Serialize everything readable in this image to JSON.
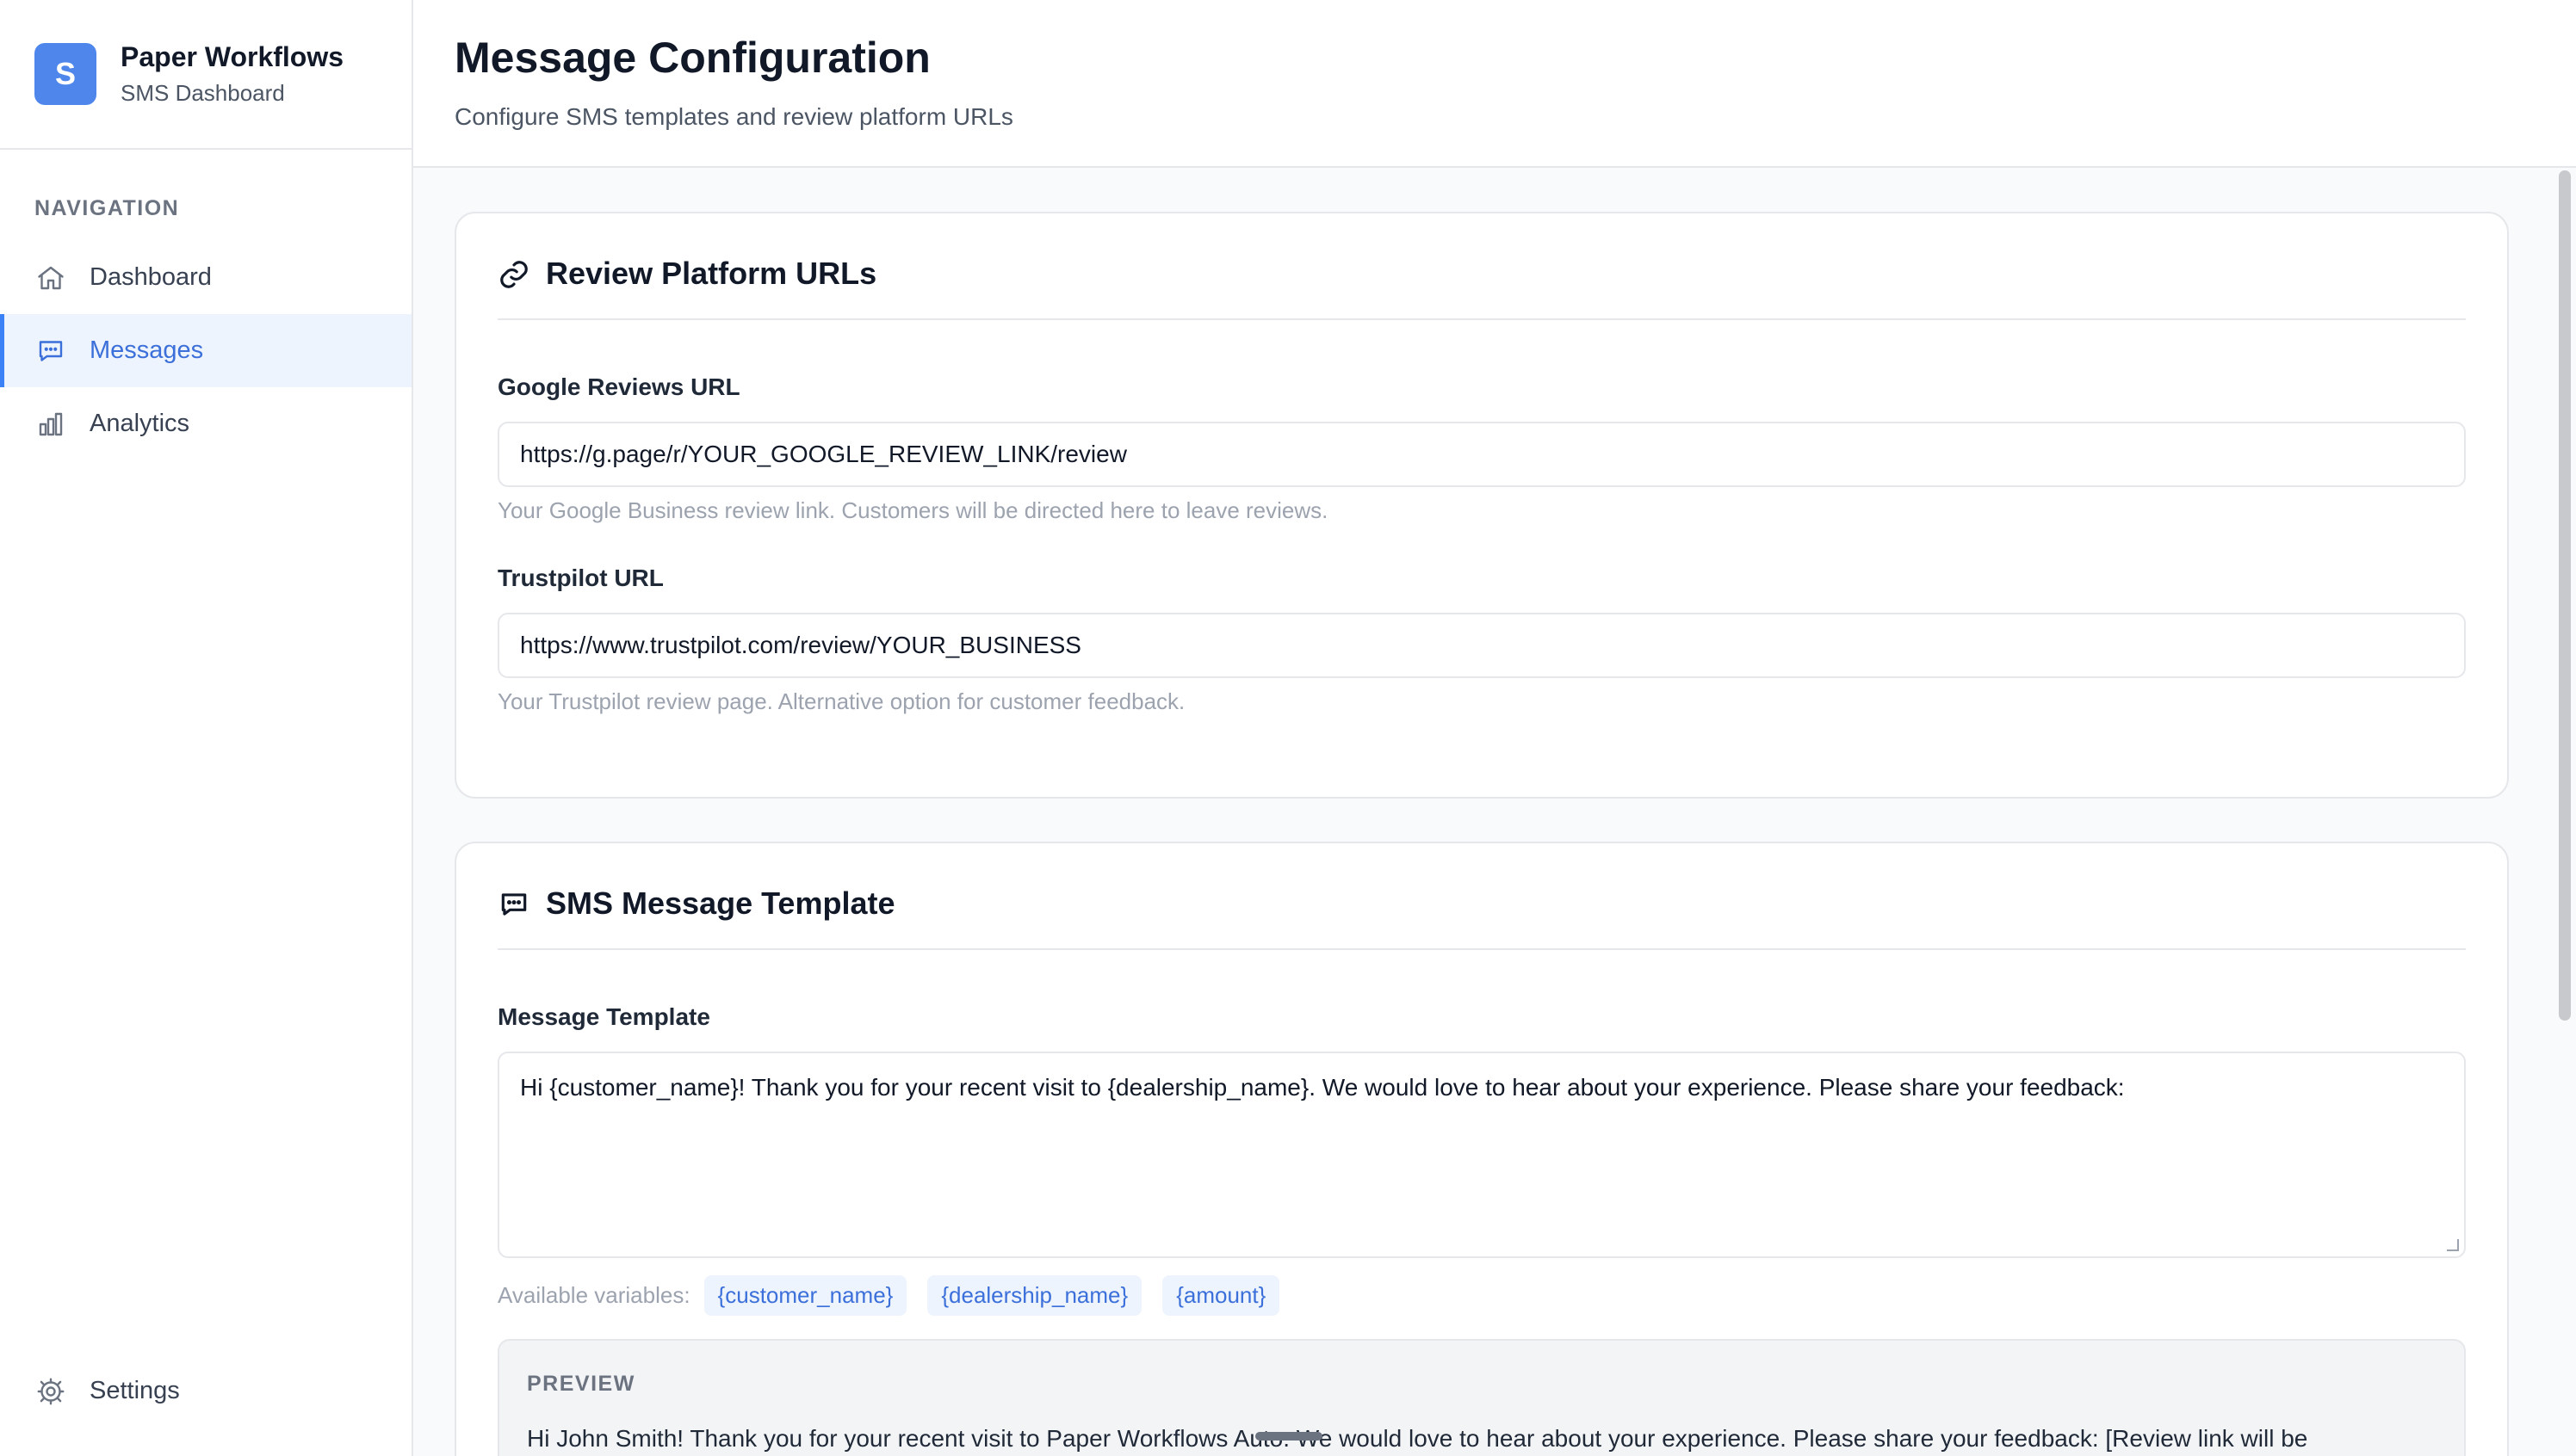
{
  "brand": {
    "logo_letter": "S",
    "title": "Paper Workflows",
    "subtitle": "SMS Dashboard"
  },
  "sidebar": {
    "heading": "NAVIGATION",
    "items": [
      {
        "label": "Dashboard",
        "icon": "home-icon",
        "active": false
      },
      {
        "label": "Messages",
        "icon": "chat-icon",
        "active": true
      },
      {
        "label": "Analytics",
        "icon": "bar-chart-icon",
        "active": false
      }
    ],
    "settings_label": "Settings"
  },
  "header": {
    "title": "Message Configuration",
    "subtitle": "Configure SMS templates and review platform URLs"
  },
  "review_card": {
    "title": "Review Platform URLs",
    "icon": "link-icon",
    "google": {
      "label": "Google Reviews URL",
      "value": "https://g.page/r/YOUR_GOOGLE_REVIEW_LINK/review",
      "help": "Your Google Business review link. Customers will be directed here to leave reviews."
    },
    "trustpilot": {
      "label": "Trustpilot URL",
      "value": "https://www.trustpilot.com/review/YOUR_BUSINESS",
      "help": "Your Trustpilot review page. Alternative option for customer feedback."
    }
  },
  "sms_card": {
    "title": "SMS Message Template",
    "icon": "chat-icon",
    "template_label": "Message Template",
    "template_value": "Hi {customer_name}! Thank you for your recent visit to {dealership_name}. We would love to hear about your experience. Please share your feedback:",
    "variables_label": "Available variables:",
    "variables": [
      "{customer_name}",
      "{dealership_name}",
      "{amount}"
    ],
    "preview_label": "PREVIEW",
    "preview_text": "Hi John Smith! Thank you for your recent visit to Paper Workflows Auto. We would love to hear about your experience. Please share your feedback: [Review link will be"
  },
  "colors": {
    "accent": "#3b82f6",
    "logo_bg": "#4f86ec",
    "active_bg": "#eef4fe"
  }
}
